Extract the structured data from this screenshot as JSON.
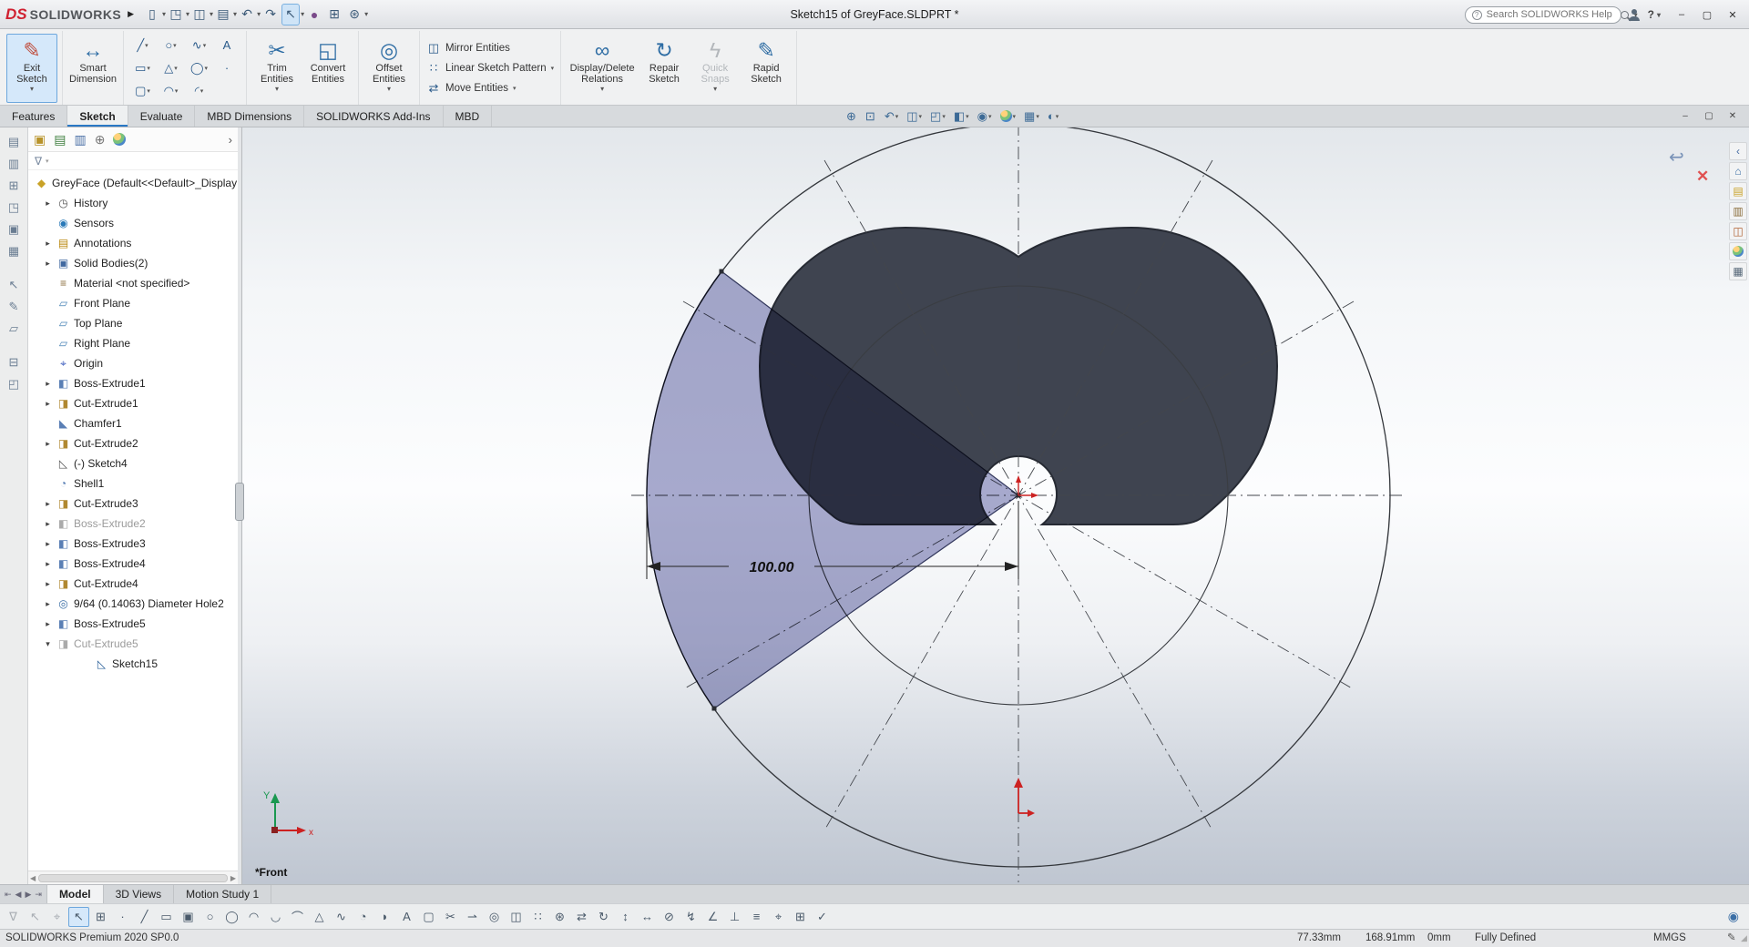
{
  "titlebar": {
    "logo": "DS",
    "brand": "SOLIDWORKS",
    "flyout": "▶",
    "title": "Sketch15 of GreyFace.SLDPRT *",
    "search_prefix": "?",
    "search_placeholder": "Search SOLIDWORKS Help",
    "help": "?",
    "help_caret": "▾",
    "icons": [
      {
        "name": "new-document-icon",
        "glyph": "▯",
        "caret": "▾"
      },
      {
        "name": "open-document-icon",
        "glyph": "◳",
        "caret": "▾"
      },
      {
        "name": "save-icon",
        "glyph": "◫",
        "caret": "▾"
      },
      {
        "name": "print-icon",
        "glyph": "▤",
        "caret": "▾"
      },
      {
        "name": "undo-icon",
        "glyph": "↶",
        "caret": "▾"
      },
      {
        "name": "redo-icon",
        "glyph": "↷",
        "caret": ""
      },
      {
        "name": "select-cursor-icon",
        "glyph": "↖",
        "caret": "▾",
        "active": true
      },
      {
        "name": "appearance-sphere-icon",
        "glyph": "●",
        "caret": "",
        "color": "#7a4a8a"
      },
      {
        "name": "sketch-grid-icon",
        "glyph": "⊞",
        "caret": ""
      },
      {
        "name": "options-gear-icon",
        "glyph": "⊛",
        "caret": "▾"
      }
    ],
    "window_controls": [
      {
        "name": "minimize-button",
        "glyph": "–"
      },
      {
        "name": "maximize-button",
        "glyph": "▢"
      },
      {
        "name": "close-button",
        "glyph": "✕"
      }
    ]
  },
  "ribbon": {
    "exit_sketch": {
      "glyph": "✎",
      "label": "Exit\nSketch",
      "caret": "▾"
    },
    "smart_dimension": {
      "glyph": "↔",
      "label": "Smart\nDimension"
    },
    "tools": [
      {
        "name": "line-tool",
        "glyph": "╱",
        "caret": "▾"
      },
      {
        "name": "corner-rectangle-tool",
        "glyph": "▭",
        "caret": "▾"
      },
      {
        "name": "straight-slot-tool",
        "glyph": "▢",
        "caret": "▾"
      },
      {
        "name": "circle-tool",
        "glyph": "○",
        "caret": "▾"
      },
      {
        "name": "polygon-tool",
        "glyph": "△",
        "caret": "▾"
      },
      {
        "name": "centerpoint-arc-tool",
        "glyph": "◠",
        "caret": "▾"
      },
      {
        "name": "spline-tool",
        "glyph": "∿",
        "caret": "▾"
      },
      {
        "name": "ellipse-tool",
        "glyph": "◯",
        "caret": "▾"
      },
      {
        "name": "sketch-fillet-tool",
        "glyph": "◜",
        "caret": "▾"
      },
      {
        "name": "text-tool",
        "glyph": "A",
        "caret": ""
      },
      {
        "name": "point-tool",
        "glyph": "·",
        "caret": ""
      }
    ],
    "trim": {
      "glyph": "✂",
      "label": "Trim\nEntities",
      "caret": "▾"
    },
    "convert": {
      "glyph": "◱",
      "label": "Convert\nEntities"
    },
    "offset": {
      "glyph": "◎",
      "label": "Offset\nEntities",
      "caret": "▾"
    },
    "mirror": {
      "glyph": "◫",
      "label": "Mirror Entities",
      "caret": ""
    },
    "linear_pattern": {
      "glyph": "∷",
      "label": "Linear Sketch Pattern",
      "caret": "▾"
    },
    "move": {
      "glyph": "⇄",
      "label": "Move Entities",
      "caret": "▾"
    },
    "display_delete": {
      "glyph": "∞",
      "label": "Display/Delete\nRelations",
      "caret": "▾"
    },
    "repair": {
      "glyph": "↻",
      "label": "Repair\nSketch"
    },
    "quick_snaps": {
      "glyph": "ϟ",
      "label": "Quick\nSnaps",
      "caret": "▾"
    },
    "rapid": {
      "glyph": "✎",
      "label": "Rapid\nSketch"
    }
  },
  "command_tabs": [
    {
      "name": "tab-features",
      "label": "Features"
    },
    {
      "name": "tab-sketch",
      "label": "Sketch",
      "active": true
    },
    {
      "name": "tab-evaluate",
      "label": "Evaluate"
    },
    {
      "name": "tab-mbd-dimensions",
      "label": "MBD Dimensions"
    },
    {
      "name": "tab-addins",
      "label": "SOLIDWORKS Add-Ins"
    },
    {
      "name": "tab-mbd",
      "label": "MBD"
    }
  ],
  "headsup": [
    {
      "name": "zoom-to-fit-icon",
      "glyph": "⊕",
      "caret": ""
    },
    {
      "name": "zoom-to-area-icon",
      "glyph": "⊡",
      "caret": ""
    },
    {
      "name": "previous-view-icon",
      "glyph": "↶",
      "caret": "▾"
    },
    {
      "name": "section-view-icon",
      "glyph": "◫",
      "caret": "▾"
    },
    {
      "name": "view-orientation-icon",
      "glyph": "◰",
      "caret": "▾"
    },
    {
      "name": "display-style-icon",
      "glyph": "◧",
      "caret": "▾"
    },
    {
      "name": "hide-show-items-icon",
      "glyph": "◉",
      "caret": "▾"
    },
    {
      "name": "edit-appearance-icon",
      "glyph": "",
      "ball": true,
      "caret": "▾"
    },
    {
      "name": "apply-scene-icon",
      "glyph": "▦",
      "caret": "▾"
    },
    {
      "name": "view-settings-icon",
      "glyph": "◐",
      "caret": "▾"
    }
  ],
  "doc_controls": [
    {
      "name": "doc-minimize-button",
      "glyph": "–"
    },
    {
      "name": "doc-restore-button",
      "glyph": "▢"
    },
    {
      "name": "doc-close-button",
      "glyph": "✕"
    }
  ],
  "dock": [
    {
      "name": "side-dock-tool-1",
      "glyph": "▤"
    },
    {
      "name": "side-dock-tool-2",
      "glyph": "▥"
    },
    {
      "name": "side-dock-tool-3",
      "glyph": "⊞"
    },
    {
      "name": "side-dock-tool-4",
      "glyph": "◳"
    },
    {
      "name": "side-dock-tool-5",
      "glyph": "▣"
    },
    {
      "name": "side-dock-tool-6",
      "glyph": "▦"
    },
    {
      "gap": true,
      "glyph": ""
    },
    {
      "name": "side-dock-tool-7",
      "glyph": "↖"
    },
    {
      "name": "side-dock-tool-8",
      "glyph": "✎"
    },
    {
      "name": "side-dock-tool-9",
      "glyph": "▱"
    },
    {
      "gap": true,
      "glyph": ""
    },
    {
      "name": "side-dock-tool-10",
      "glyph": "⊟"
    },
    {
      "name": "side-dock-tool-11",
      "glyph": "◰"
    }
  ],
  "panel": {
    "tabs": [
      {
        "name": "featuremanager-tree-tab",
        "glyph": "▣",
        "color": "#b8932a"
      },
      {
        "name": "propertymanager-tab",
        "glyph": "▤",
        "color": "#3f7f3f"
      },
      {
        "name": "configurationmanager-tab",
        "glyph": "▥",
        "color": "#4a6fa5"
      },
      {
        "name": "dimxpertmanager-tab",
        "glyph": "⊕",
        "color": "#777777"
      },
      {
        "name": "displaymanager-tab",
        "glyph": "",
        "ball": true
      }
    ],
    "chevron": "›",
    "filter_glyph": "∇",
    "filter_caret": "▾",
    "root": {
      "label": "GreyFace (Default<<Default>_Display",
      "glyph": "◆",
      "color": "#c9a227"
    },
    "tree": [
      {
        "name": "tree-item-history",
        "label": "History",
        "arrow": "▸",
        "glyph": "◷",
        "color": "#555555"
      },
      {
        "name": "tree-item-sensors",
        "label": "Sensors",
        "arrow": "",
        "glyph": "◉",
        "color": "#2a7ab8"
      },
      {
        "name": "tree-item-annotations",
        "label": "Annotations",
        "arrow": "▸",
        "glyph": "▤",
        "color": "#b8860b"
      },
      {
        "name": "tree-item-solid-bodies",
        "label": "Solid Bodies(2)",
        "arrow": "▸",
        "glyph": "▣",
        "color": "#4169a0"
      },
      {
        "name": "tree-item-material",
        "label": "Material <not specified>",
        "arrow": "",
        "glyph": "≡",
        "color": "#8a6d3b"
      },
      {
        "name": "tree-item-front-plane",
        "label": "Front Plane",
        "arrow": "",
        "glyph": "▱",
        "color": "#4682b4"
      },
      {
        "name": "tree-item-top-plane",
        "label": "Top Plane",
        "arrow": "",
        "glyph": "▱",
        "color": "#4682b4"
      },
      {
        "name": "tree-item-right-plane",
        "label": "Right Plane",
        "arrow": "",
        "glyph": "▱",
        "color": "#4682b4"
      },
      {
        "name": "tree-item-origin",
        "label": "Origin",
        "arrow": "",
        "glyph": "⌖",
        "color": "#3355bb"
      },
      {
        "name": "tree-item-boss-extrude1",
        "label": "Boss-Extrude1",
        "arrow": "▸",
        "glyph": "◧",
        "color": "#5a7fb5"
      },
      {
        "name": "tree-item-cut-extrude1",
        "label": "Cut-Extrude1",
        "arrow": "▸",
        "glyph": "◨",
        "color": "#b08830"
      },
      {
        "name": "tree-item-chamfer1",
        "label": "Chamfer1",
        "arrow": "",
        "glyph": "◣",
        "color": "#5a7fb5"
      },
      {
        "name": "tree-item-cut-extrude2",
        "label": "Cut-Extrude2",
        "arrow": "▸",
        "glyph": "◨",
        "color": "#b08830"
      },
      {
        "name": "tree-item-sketch4",
        "label": "(-) Sketch4",
        "arrow": "",
        "glyph": "◺",
        "color": "#555555"
      },
      {
        "name": "tree-item-shell1",
        "label": "Shell1",
        "arrow": "",
        "glyph": "◔",
        "color": "#5a7fb5"
      },
      {
        "name": "tree-item-cut-extrude3",
        "label": "Cut-Extrude3",
        "arrow": "▸",
        "glyph": "◨",
        "color": "#b08830"
      },
      {
        "name": "tree-item-boss-extrude2",
        "label": "Boss-Extrude2",
        "arrow": "▸",
        "glyph": "◧",
        "color": "#aaaaaa",
        "grey": true
      },
      {
        "name": "tree-item-boss-extrude3",
        "label": "Boss-Extrude3",
        "arrow": "▸",
        "glyph": "◧",
        "color": "#5a7fb5"
      },
      {
        "name": "tree-item-boss-extrude4",
        "label": "Boss-Extrude4",
        "arrow": "▸",
        "glyph": "◧",
        "color": "#5a7fb5"
      },
      {
        "name": "tree-item-cut-extrude4",
        "label": "Cut-Extrude4",
        "arrow": "▸",
        "glyph": "◨",
        "color": "#b08830"
      },
      {
        "name": "tree-item-diameter-hole2",
        "label": "9/64 (0.14063) Diameter Hole2",
        "arrow": "▸",
        "glyph": "◎",
        "color": "#3a6ea5"
      },
      {
        "name": "tree-item-boss-extrude5",
        "label": "Boss-Extrude5",
        "arrow": "▸",
        "glyph": "◧",
        "color": "#5a7fb5"
      },
      {
        "name": "tree-item-cut-extrude5",
        "label": "Cut-Extrude5",
        "arrow": "▾",
        "glyph": "◨",
        "color": "#aaaaaa",
        "grey": true
      },
      {
        "name": "tree-item-sketch15",
        "label": "Sketch15",
        "arrow": "",
        "glyph": "◺",
        "color": "#2a6099",
        "deep": true
      }
    ],
    "hscroll_left": "◀",
    "hscroll_right": "▶"
  },
  "viewport": {
    "dimension": "100.00",
    "view_label": "*Front",
    "confirm_arrow": "↩",
    "confirm_x": "✕",
    "triad": {
      "y_label": "Y",
      "x_label": "x"
    },
    "taskpane": [
      {
        "name": "taskpane-collapse-icon",
        "glyph": "‹",
        "color": "#4a6fa5"
      },
      {
        "name": "solidworks-resources-icon",
        "glyph": "⌂",
        "color": "#3a6ea5"
      },
      {
        "name": "design-library-icon",
        "glyph": "▤",
        "color": "#c9a227"
      },
      {
        "name": "file-explorer-icon",
        "glyph": "▥",
        "color": "#8a6d3b"
      },
      {
        "name": "view-palette-icon",
        "glyph": "◫",
        "color": "#b06030"
      },
      {
        "name": "appearances-scenes-icon",
        "glyph": "",
        "ball": true
      },
      {
        "name": "custom-properties-icon",
        "glyph": "▦",
        "color": "#556677"
      }
    ]
  },
  "model_tabs": {
    "nav": [
      {
        "name": "first-tab-button",
        "glyph": "⇤"
      },
      {
        "name": "prev-tab-button",
        "glyph": "◀"
      },
      {
        "name": "next-tab-button",
        "glyph": "▶"
      },
      {
        "name": "last-tab-button",
        "glyph": "⇥"
      }
    ],
    "tabs": [
      {
        "name": "model-tab",
        "label": "Model",
        "active": true
      },
      {
        "name": "3d-views-tab",
        "label": "3D Views"
      },
      {
        "name": "motion-study-tab",
        "label": "Motion Study 1"
      }
    ]
  },
  "bottom_toolbar": [
    {
      "name": "selection-filter-icon",
      "glyph": "∇",
      "dim": true
    },
    {
      "name": "select-icon",
      "glyph": "↖",
      "dim": true
    },
    {
      "name": "snap-target-icon",
      "glyph": "⌖",
      "dim": true
    },
    {
      "name": "select-mode-icon",
      "glyph": "↖",
      "active": true
    },
    {
      "name": "grid-icon",
      "glyph": "⊞"
    },
    {
      "name": "point-tool-icon",
      "glyph": "·"
    },
    {
      "name": "line-tool-icon",
      "glyph": "╱"
    },
    {
      "name": "rectangle-tool-icon",
      "glyph": "▭"
    },
    {
      "name": "center-rectangle-tool-icon",
      "glyph": "▣"
    },
    {
      "name": "circle-tool-icon",
      "glyph": "○"
    },
    {
      "name": "perimeter-circle-tool-icon",
      "glyph": "◯"
    },
    {
      "name": "arc-tool-icon",
      "glyph": "◠"
    },
    {
      "name": "tangent-arc-tool-icon",
      "glyph": "◡"
    },
    {
      "name": "three-point-arc-tool-icon",
      "glyph": "⌒"
    },
    {
      "name": "polygon-tool-icon",
      "glyph": "△"
    },
    {
      "name": "spline-tool-icon",
      "glyph": "∿"
    },
    {
      "name": "ellipse-tool-icon",
      "glyph": "◔"
    },
    {
      "name": "partial-ellipse-tool-icon",
      "glyph": "◗"
    },
    {
      "name": "text-tool-icon",
      "glyph": "A"
    },
    {
      "name": "slot-tool-icon",
      "glyph": "▢"
    },
    {
      "name": "trim-entities-icon",
      "glyph": "✂"
    },
    {
      "name": "extend-entities-icon",
      "glyph": "⇀"
    },
    {
      "name": "offset-entities-icon",
      "glyph": "◎"
    },
    {
      "name": "mirror-entities-icon",
      "glyph": "◫"
    },
    {
      "name": "linear-pattern-icon",
      "glyph": "∷"
    },
    {
      "name": "circular-pattern-icon",
      "glyph": "⊛"
    },
    {
      "name": "move-entities-icon",
      "glyph": "⇄"
    },
    {
      "name": "rotate-entities-icon",
      "glyph": "↻"
    },
    {
      "name": "scale-entities-icon",
      "glyph": "↕"
    },
    {
      "name": "stretch-entities-icon",
      "glyph": "↔"
    },
    {
      "name": "split-entities-icon",
      "glyph": "⊘"
    },
    {
      "name": "jog-line-icon",
      "glyph": "↯"
    },
    {
      "name": "angle-dimension-icon",
      "glyph": "∠"
    },
    {
      "name": "perpendicular-relation-icon",
      "glyph": "⊥"
    },
    {
      "name": "relations-icon",
      "glyph": "≡"
    },
    {
      "name": "snap-icon",
      "glyph": "⌖"
    },
    {
      "name": "grid-settings-icon",
      "glyph": "⊞"
    },
    {
      "name": "fully-define-sketch-icon",
      "glyph": "✓"
    }
  ],
  "bottom_right_glyph": "◉",
  "statusbar": {
    "left": "SOLIDWORKS Premium 2020 SP0.0",
    "x": "77.33mm",
    "y": "168.91mm",
    "z": "0mm",
    "state": "Fully Defined",
    "units": "MMGS",
    "edit_glyph": "✎",
    "grip_glyph": "◢"
  }
}
